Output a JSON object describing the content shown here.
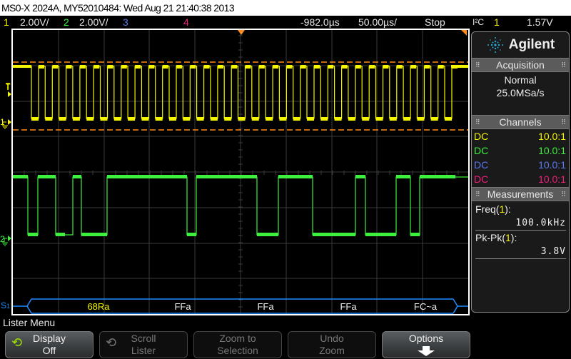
{
  "title_bar": {
    "text": "MS0-X 2024A, MY52010484: Wed Aug 21 21:40:38 2013"
  },
  "status_bar": {
    "ch1": {
      "num": "1",
      "scale": "2.00V/"
    },
    "ch2": {
      "num": "2",
      "scale": "2.00V/"
    },
    "ch3": {
      "num": "3"
    },
    "ch4": {
      "num": "4"
    },
    "time_delay": "-982.0µs",
    "time_scale": "50.00µs/",
    "run_state": "Stop",
    "trigger_type": "I²C",
    "trigger_source": "1",
    "trigger_level": "1.57V"
  },
  "graticule": {
    "side_markers": {
      "trigger": "T",
      "ch1": "1",
      "ch2": "2",
      "serial": "S",
      "serial_sub": "1"
    },
    "decode": {
      "bus_color": "#1e8cff",
      "labels": [
        {
          "text": "68Ra",
          "color": "#f5f500"
        },
        {
          "text": "FFa",
          "color": "#f0f0f0"
        },
        {
          "text": "FFa",
          "color": "#f0f0f0"
        },
        {
          "text": "FFa",
          "color": "#f0f0f0"
        },
        {
          "text": "FC~a",
          "color": "#f0f0f0"
        }
      ]
    },
    "channel_colors": {
      "ch1": "#f5f500",
      "ch2": "#3ef03e",
      "threshold": "#ff8c1a"
    }
  },
  "side_panel": {
    "brand": "Agilent",
    "acquisition": {
      "heading": "Acquisition",
      "mode": "Normal",
      "sample_rate": "25.0MSa/s"
    },
    "channels": {
      "heading": "Channels",
      "rows": [
        {
          "coupling": "DC",
          "probe": "10.0:1",
          "color": "#f5f500"
        },
        {
          "coupling": "DC",
          "probe": "10.0:1",
          "color": "#3ef03e"
        },
        {
          "coupling": "DC",
          "probe": "10.0:1",
          "color": "#5b78f0"
        },
        {
          "coupling": "DC",
          "probe": "10.0:1",
          "color": "#f0207a"
        }
      ]
    },
    "measurements": {
      "heading": "Measurements",
      "items": [
        {
          "label": "Freq(",
          "src": "1",
          "suffix": "):",
          "value": "100.0kHz"
        },
        {
          "label": "Pk-Pk(",
          "src": "1",
          "suffix": "):",
          "value": "3.8V"
        }
      ]
    }
  },
  "menu": {
    "title": "Lister Menu",
    "softkeys": [
      {
        "line1": "Display",
        "line2": "Off",
        "state": "active",
        "icon": "rotate-icon"
      },
      {
        "line1": "Scroll",
        "line2": "Lister",
        "state": "disabled",
        "icon": "rotate-icon"
      },
      {
        "line1": "Zoom to",
        "line2": "Selection",
        "state": "disabled"
      },
      {
        "line1": "Undo",
        "line2": "Zoom",
        "state": "disabled"
      },
      {
        "line1": "Options",
        "line2": "",
        "state": "active",
        "icon": "arrow-down-icon"
      }
    ]
  }
}
